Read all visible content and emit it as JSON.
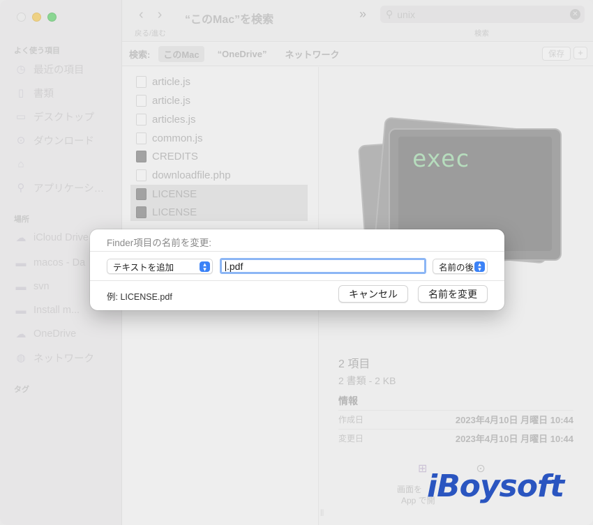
{
  "window": {
    "title": "“このMac”を検索"
  },
  "toolbar": {
    "nav_label": "戻る/進む",
    "search_value": "unix",
    "search_label": "検索"
  },
  "sidebar": {
    "favorites_header": "よく使う項目",
    "favorites": [
      {
        "label": "最近の項目",
        "icon": "clock-icon"
      },
      {
        "label": "書類",
        "icon": "document-icon"
      },
      {
        "label": "デスクトップ",
        "icon": "desktop-icon"
      },
      {
        "label": "ダウンロード",
        "icon": "download-icon"
      },
      {
        "label": "",
        "icon": "home-icon"
      },
      {
        "label": "アプリケーシ…",
        "icon": "applications-icon"
      }
    ],
    "locations_header": "場所",
    "locations": [
      {
        "label": "iCloud Drive",
        "icon": "cloud-icon"
      },
      {
        "label": "macos - Da",
        "icon": "disk-icon"
      },
      {
        "label": "svn",
        "icon": "disk-icon"
      },
      {
        "label": "Install m...",
        "icon": "disk-icon"
      },
      {
        "label": "OneDrive",
        "icon": "cloud-icon"
      },
      {
        "label": "ネットワーク",
        "icon": "network-icon"
      }
    ],
    "tags_header": "タグ"
  },
  "scope": {
    "label": "検索:",
    "options": [
      "このMac",
      "“OneDrive”",
      "ネットワーク"
    ],
    "save_label": "保存",
    "plus_label": "+"
  },
  "files": [
    {
      "name": "article.js",
      "dark": false,
      "selected": false
    },
    {
      "name": "article.js",
      "dark": false,
      "selected": false
    },
    {
      "name": "articles.js",
      "dark": false,
      "selected": false
    },
    {
      "name": "common.js",
      "dark": false,
      "selected": false
    },
    {
      "name": "CREDITS",
      "dark": true,
      "selected": false
    },
    {
      "name": "downloadfile.php",
      "dark": false,
      "selected": false
    },
    {
      "name": "LICENSE",
      "dark": true,
      "selected": true
    },
    {
      "name": "LICENSE",
      "dark": true,
      "selected": true
    }
  ],
  "preview": {
    "icon_text": "exec",
    "count": "2 項目",
    "subtitle": "2 書類 - 2 KB",
    "info_header": "情報",
    "created_label": "作成日",
    "created_value": "2023年4月10日 月曜日 10:44",
    "modified_label": "変更日",
    "modified_value": "2023年4月10日 月曜日 10:44",
    "action_label_1": "画面を",
    "action_label_2": "App で開"
  },
  "dialog": {
    "title": "Finder項目の名前を変更:",
    "mode_select": "テキストを追加",
    "text_value": ".pdf",
    "position_select": "名前の後",
    "example": "例: LICENSE.pdf",
    "cancel_label": "キャンセル",
    "rename_label": "名前を変更"
  },
  "watermark": "iBoysoft",
  "colors": {
    "accent": "#3b82f7",
    "focus_ring": "#8cb6f5",
    "exec_text": "#8fd49b",
    "watermark": "#2a55c0"
  }
}
